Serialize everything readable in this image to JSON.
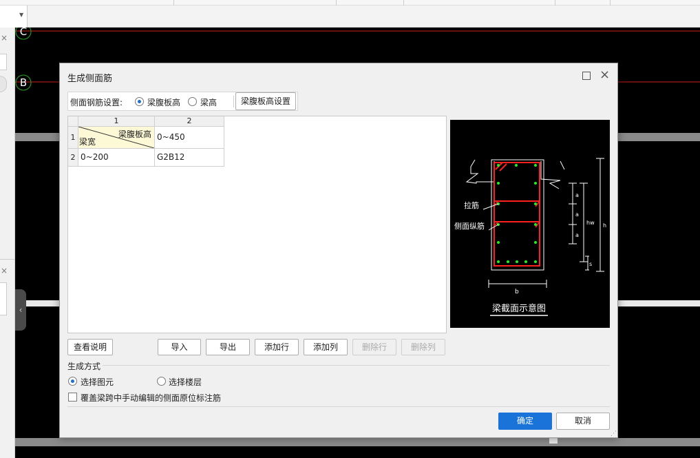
{
  "background": {
    "axis_labels": [
      "C",
      "B"
    ],
    "collapse_arrow": "‹",
    "close_glyph": "×"
  },
  "dialog": {
    "title": "生成侧面筋",
    "setting_label": "侧面钢筋设置:",
    "radio_web_height": "梁腹板高",
    "radio_beam_height": "梁高",
    "web_height_settings_button": "梁腹板高设置",
    "grid": {
      "col_headers": [
        "1",
        "2"
      ],
      "row_headers": [
        "1",
        "2"
      ],
      "corner_top": "梁腹板高",
      "corner_bottom": "梁宽",
      "r1c2": "0~450",
      "r2c1": "0~200",
      "r2c2": "G2B12"
    },
    "preview": {
      "tie_label": "拉筋",
      "side_bar_label": "侧面纵筋",
      "caption": "梁截面示意图",
      "dim_a": "a",
      "dim_hw": "hw",
      "dim_h": "h",
      "dim_s": "s",
      "dim_b": "b"
    },
    "buttons": {
      "view_help": "查看说明",
      "import": "导入",
      "export": "导出",
      "add_row": "添加行",
      "add_col": "添加列",
      "delete_row": "删除行",
      "delete_col": "删除列"
    },
    "generation_mode_label": "生成方式",
    "radio_select_element": "选择图元",
    "radio_select_floor": "选择楼层",
    "overwrite_checkbox_label": "覆盖梁跨中手动编辑的侧面原位标注筋",
    "ok_button": "确定",
    "cancel_button": "取消"
  },
  "colors": {
    "accent": "#1a73d9",
    "rebar": "#ff2020",
    "dot": "#22ee22",
    "axis": "#22aa22"
  }
}
